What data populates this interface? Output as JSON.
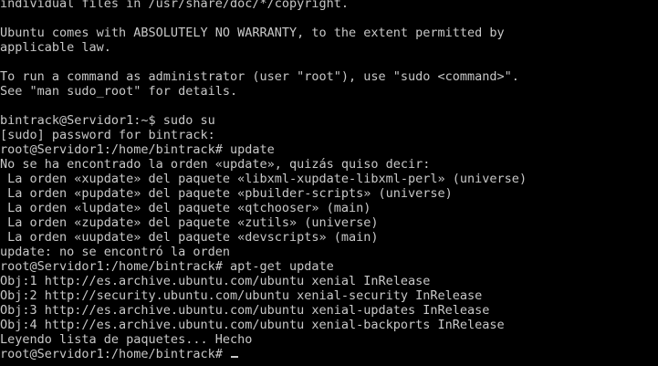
{
  "terminal": {
    "lines": [
      "individual files in /usr/share/doc/*/copyright.",
      "",
      "Ubuntu comes with ABSOLUTELY NO WARRANTY, to the extent permitted by",
      "applicable law.",
      "",
      "To run a command as administrator (user \"root\"), use \"sudo <command>\".",
      "See \"man sudo_root\" for details.",
      "",
      "bintrack@Servidor1:~$ sudo su",
      "[sudo] password for bintrack:",
      "root@Servidor1:/home/bintrack# update",
      "No se ha encontrado la orden «update», quizás quiso decir:",
      " La orden «xupdate» del paquete «libxml-xupdate-libxml-perl» (universe)",
      " La orden «pupdate» del paquete «pbuilder-scripts» (universe)",
      " La orden «lupdate» del paquete «qtchooser» (main)",
      " La orden «zupdate» del paquete «zutils» (universe)",
      " La orden «uupdate» del paquete «devscripts» (main)",
      "update: no se encontró la orden",
      "root@Servidor1:/home/bintrack# apt-get update",
      "Obj:1 http://es.archive.ubuntu.com/ubuntu xenial InRelease",
      "Obj:2 http://security.ubuntu.com/ubuntu xenial-security InRelease",
      "Obj:3 http://es.archive.ubuntu.com/ubuntu xenial-updates InRelease",
      "Obj:4 http://es.archive.ubuntu.com/ubuntu xenial-backports InRelease",
      "Leyendo lista de paquetes... Hecho"
    ],
    "prompt": "root@Servidor1:/home/bintrack# "
  },
  "colors": {
    "background": "#000000",
    "foreground": "#c8c8c8"
  }
}
